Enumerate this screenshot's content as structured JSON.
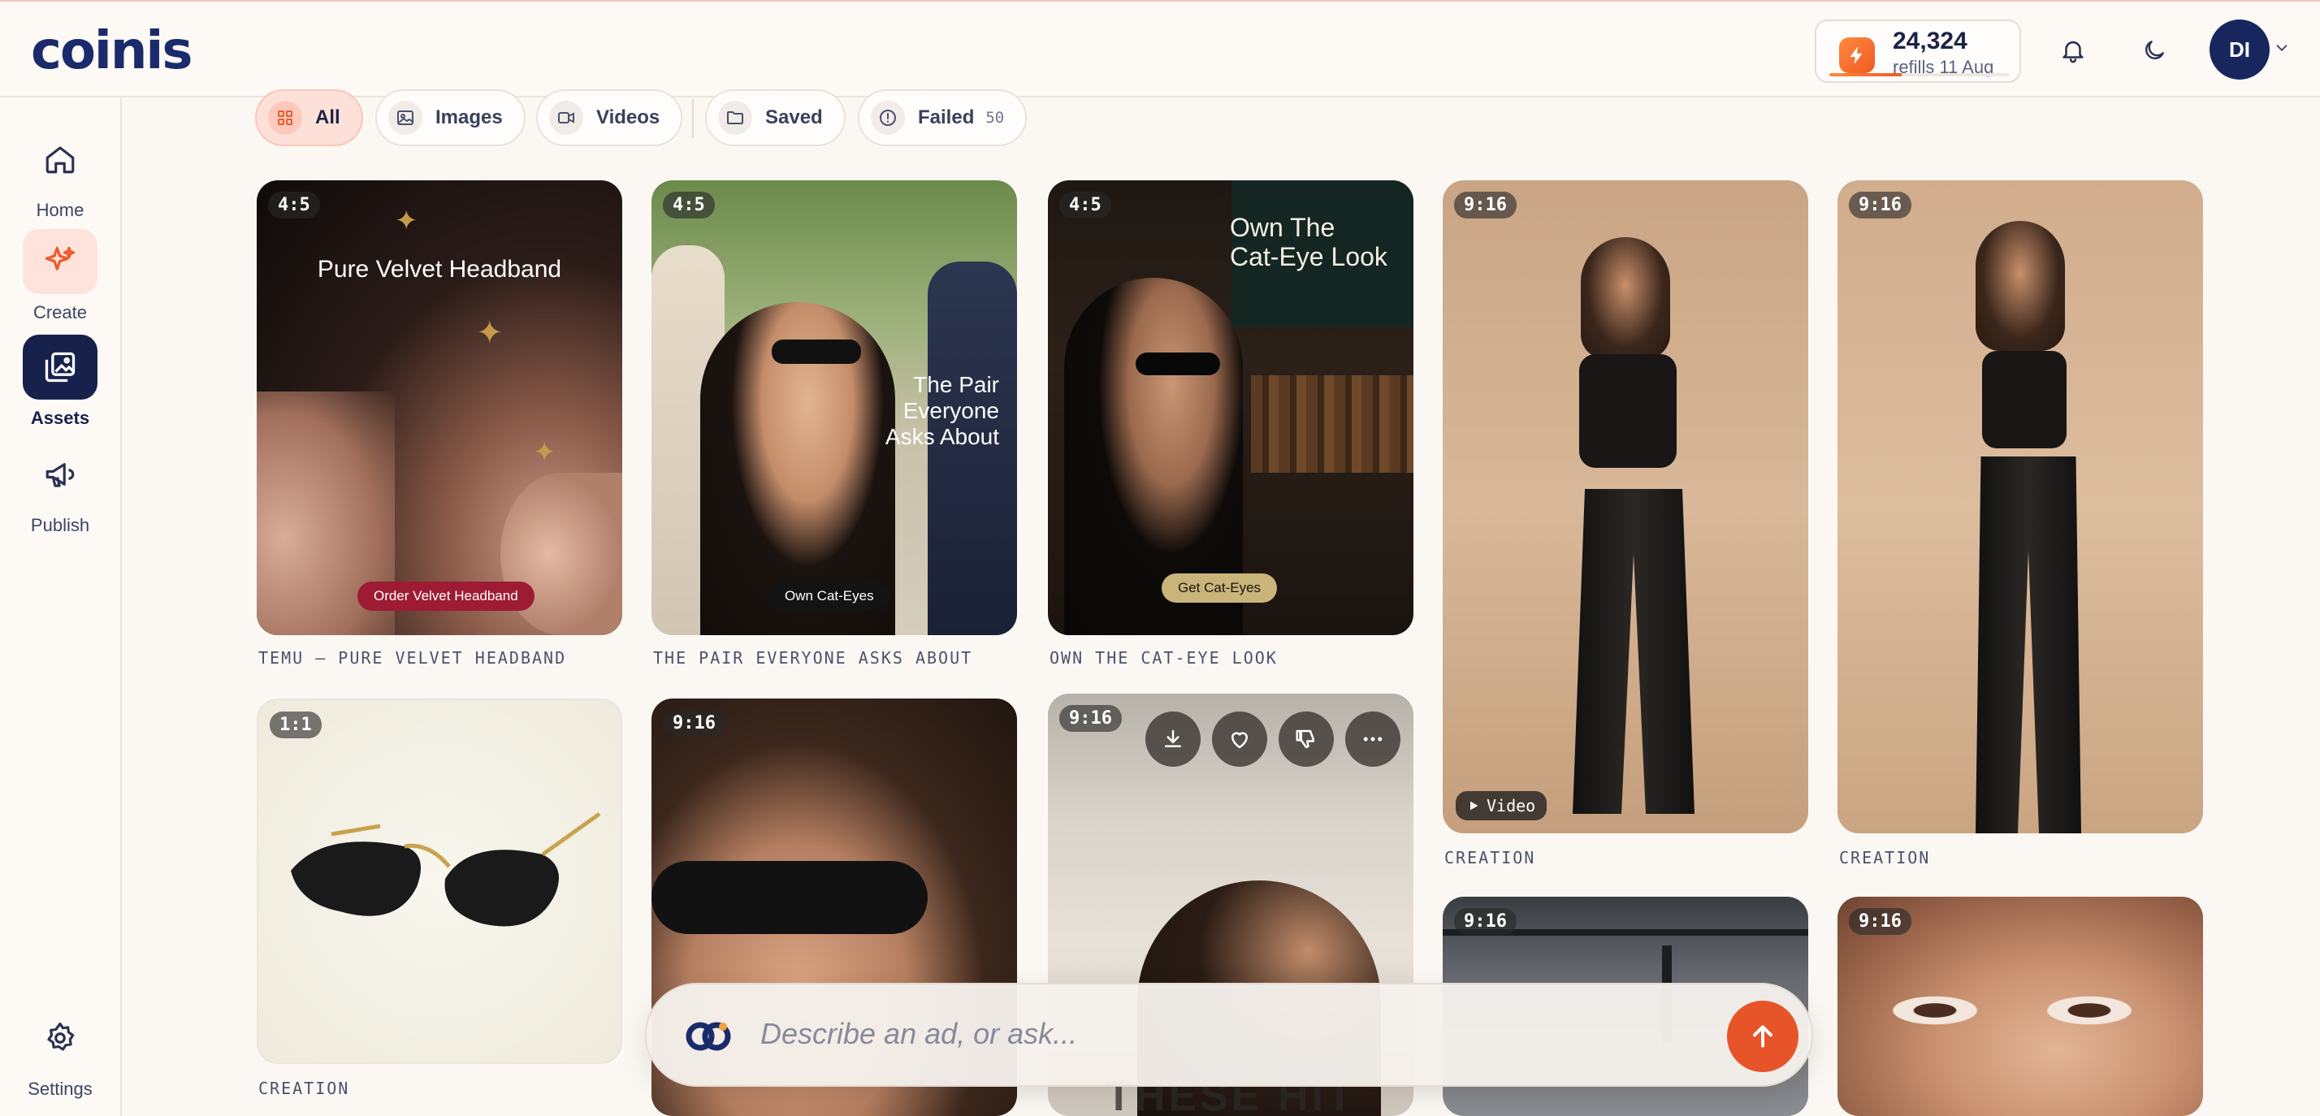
{
  "app": {
    "logo_text": "coinis"
  },
  "header": {
    "credits_amount": "24,324",
    "credits_refill": "refills 11 Aug",
    "credits_fraction": 0.4,
    "avatar_initials": "DI"
  },
  "sidebar": {
    "items": [
      {
        "label": "Home",
        "icon": "home-icon"
      },
      {
        "label": "Create",
        "icon": "sparkle-icon"
      },
      {
        "label": "Assets",
        "icon": "gallery-icon",
        "active": true
      },
      {
        "label": "Publish",
        "icon": "megaphone-icon"
      }
    ],
    "settings_label": "Settings"
  },
  "filters": [
    {
      "label": "All",
      "icon": "grid-icon",
      "active": true
    },
    {
      "label": "Images",
      "icon": "image-icon"
    },
    {
      "label": "Videos",
      "icon": "video-icon"
    },
    {
      "label": "Saved",
      "icon": "folder-icon"
    },
    {
      "label": "Failed",
      "icon": "alert-circle-icon",
      "count": "50"
    }
  ],
  "assets": [
    {
      "ratio": "4:5",
      "headline": "Pure Velvet Headband",
      "cta": "Order Velvet Headband",
      "caption": "TEMU — PURE VELVET HEADBAND"
    },
    {
      "ratio": "4:5",
      "headline_lines": [
        "The Pair",
        "Everyone",
        "Asks About"
      ],
      "cta": "Own Cat-Eyes",
      "caption": "THE PAIR EVERYONE ASKS ABOUT"
    },
    {
      "ratio": "4:5",
      "headline_lines": [
        "Own The",
        "Cat-Eye Look"
      ],
      "cta": "Get Cat-Eyes",
      "caption": "OWN THE CAT-EYE LOOK"
    },
    {
      "ratio": "9:16",
      "badge": "Video",
      "caption": "CREATION"
    },
    {
      "ratio": "9:16",
      "caption": "CREATION"
    },
    {
      "ratio": "1:1",
      "caption": "CREATION"
    },
    {
      "ratio": "9:16"
    },
    {
      "ratio": "9:16",
      "bottom_text": "THESE HIT"
    },
    {
      "ratio": "9:16"
    },
    {
      "ratio": "9:16"
    }
  ],
  "prompt": {
    "placeholder": "Describe an ad, or ask..."
  }
}
